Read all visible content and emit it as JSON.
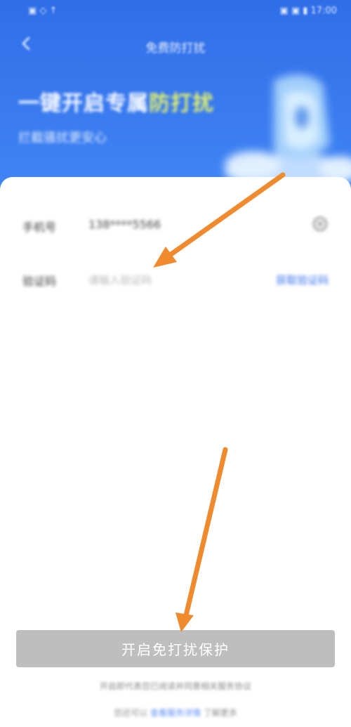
{
  "status_bar": {
    "left_text": "▣ ◇ ↑",
    "right_text": "▣ ▣ ▮ 17:00"
  },
  "nav": {
    "title": "免费防打扰"
  },
  "hero": {
    "title_main": "一键开启专属",
    "title_highlight": "防打扰",
    "subtitle": "拦截骚扰更安心"
  },
  "form": {
    "phone_row": {
      "label": "手机号",
      "value": "138****5566"
    },
    "code_row": {
      "label": "验证码",
      "placeholder": "请输入验证码",
      "action": "获取验证码"
    }
  },
  "submit_button": {
    "label": "开启免打扰保护"
  },
  "agreement": {
    "line1": "开启即代表您已阅读并同意相关服务协议",
    "line2_prefix": "您还可以",
    "line2_link": "查看服务详情",
    "line2_suffix": "了解更多"
  },
  "colors": {
    "header_blue": "#2f6ee8",
    "highlight_yellow": "#e6f36a",
    "button_gray": "#bebebe",
    "arrow_orange": "#f08a2e"
  }
}
